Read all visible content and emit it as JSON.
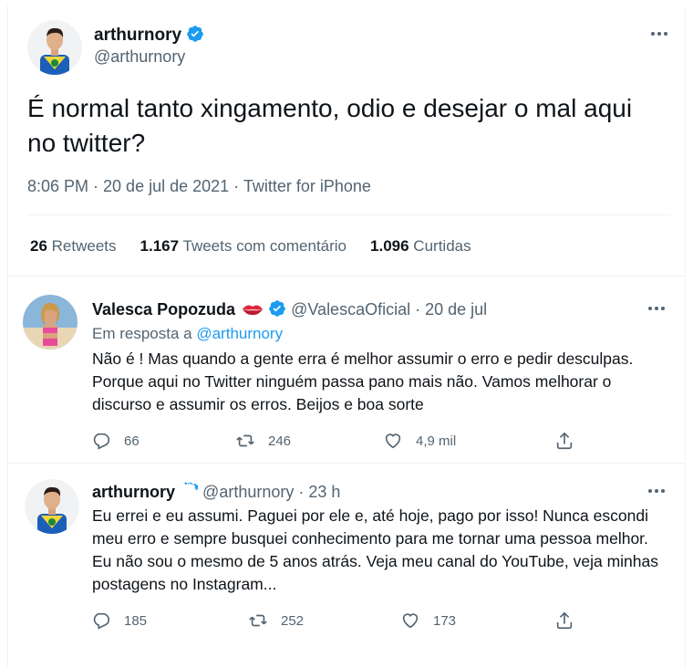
{
  "main_tweet": {
    "name": "arthurnory",
    "handle": "@arthurnory",
    "text": "É normal tanto xingamento, odio e desejar o mal aqui no twitter?",
    "meta": "8:06 PM · 20 de jul de 2021 · Twitter for iPhone",
    "stats": {
      "retweets_count": "26",
      "retweets_label": "Retweets",
      "quotes_count": "1.167",
      "quotes_label": "Tweets com comentário",
      "likes_count": "1.096",
      "likes_label": "Curtidas"
    }
  },
  "replies": [
    {
      "name": "Valesca Popozuda",
      "handle": "@ValescaOficial",
      "date": "· 20 de jul",
      "reply_to_prefix": "Em resposta a",
      "reply_to_handle": "@arthurnory",
      "text": "Não é ! Mas quando a gente erra é melhor assumir o erro e pedir desculpas. Porque aqui no Twitter ninguém passa pano mais não. Vamos melhorar o discurso e assumir os erros. Beijos e boa sorte",
      "replies_count": "66",
      "retweets_count": "246",
      "likes_count": "4,9 mil"
    },
    {
      "name": "arthurnory",
      "handle": "@arthurnory",
      "date": "· 23 h",
      "text": "Eu errei e eu assumi. Paguei por ele e, até hoje, pago por isso! Nunca escondi meu erro e sempre busquei conhecimento para me tornar uma pessoa melhor. Eu não sou o mesmo de 5 anos atrás. Veja meu canal do YouTube, veja minhas postagens no Instagram...",
      "replies_count": "185",
      "retweets_count": "252",
      "likes_count": "173"
    }
  ],
  "icons": {
    "verified": "verified-badge-icon",
    "more": "more-options-icon",
    "reply": "reply-icon",
    "retweet": "retweet-icon",
    "like": "heart-icon",
    "share": "share-icon",
    "lips": "kiss-mark-emoji"
  },
  "colors": {
    "accent": "#1d9bf0",
    "secondary_text": "#536471",
    "primary_text": "#0f1419"
  }
}
